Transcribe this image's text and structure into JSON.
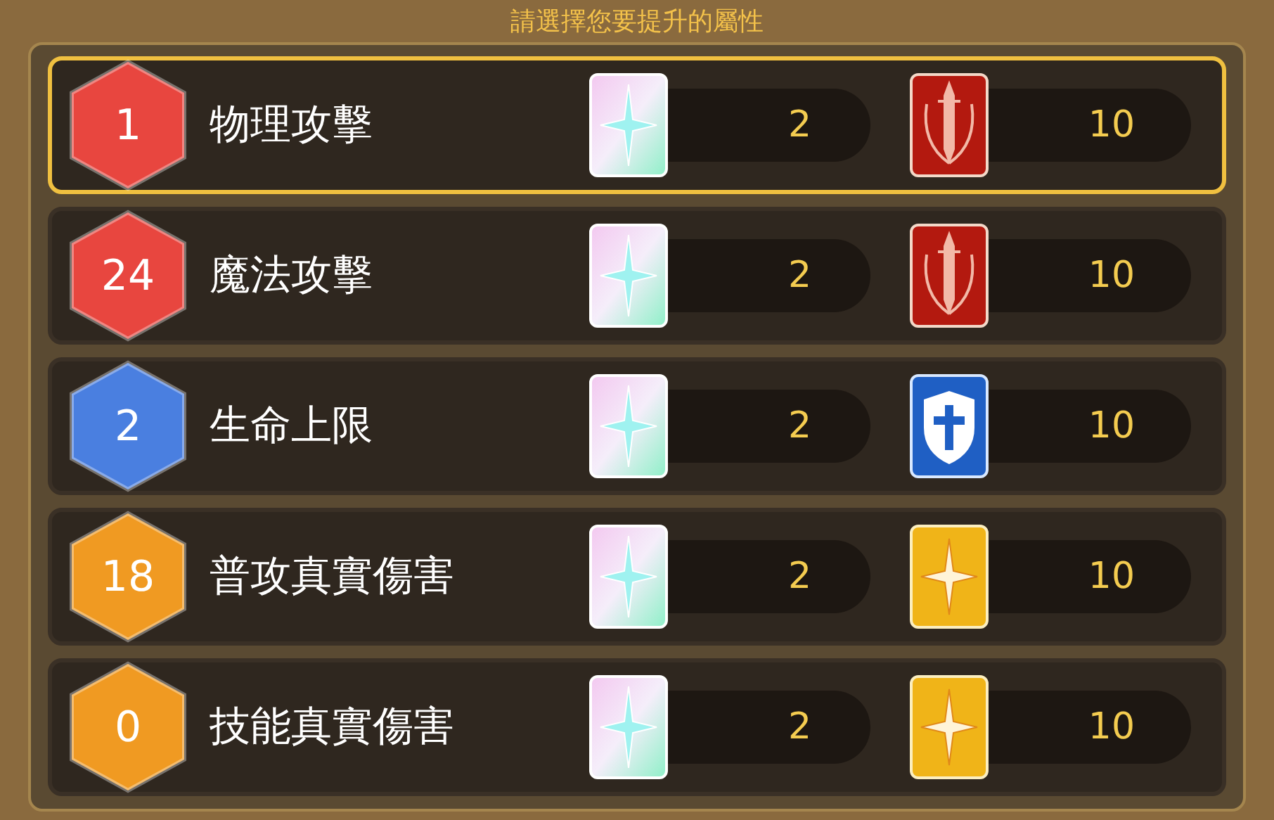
{
  "title": "請選擇您要提升的屬性",
  "rows": [
    {
      "rank": "1",
      "color": "#e8463f",
      "name": "物理攻擊",
      "cost_1": "2",
      "kind": "sword",
      "cost_2": "10",
      "selected": true
    },
    {
      "rank": "24",
      "color": "#e8463f",
      "name": "魔法攻擊",
      "cost_1": "2",
      "kind": "sword",
      "cost_2": "10",
      "selected": false
    },
    {
      "rank": "2",
      "color": "#4a7fe0",
      "name": "生命上限",
      "cost_1": "2",
      "kind": "shield",
      "cost_2": "10",
      "selected": false
    },
    {
      "rank": "18",
      "color": "#f09a22",
      "name": "普攻真實傷害",
      "cost_1": "2",
      "kind": "star",
      "cost_2": "10",
      "selected": false
    },
    {
      "rank": "0",
      "color": "#f09a22",
      "name": "技能真實傷害",
      "cost_1": "2",
      "kind": "star",
      "cost_2": "10",
      "selected": false
    }
  ]
}
